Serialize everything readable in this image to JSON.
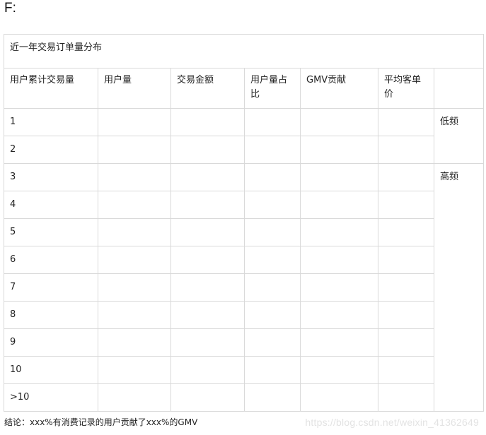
{
  "heading": "F:",
  "table": {
    "caption": "近一年交易订单量分布",
    "headers": [
      "用户累计交易量",
      "用户量",
      "交易金额",
      "用户量占比",
      "GMV贡献",
      "平均客单价",
      ""
    ],
    "rows": [
      "1",
      "2",
      "3",
      "4",
      "5",
      "6",
      "7",
      "8",
      "9",
      "10",
      ">10"
    ],
    "bands": {
      "low": "低频",
      "high": "高频"
    }
  },
  "conclusion": "结论：xxx%有消费记录的用户贡献了xxx%的GMV",
  "watermark": "https://blog.csdn.net/weixin_41362649"
}
